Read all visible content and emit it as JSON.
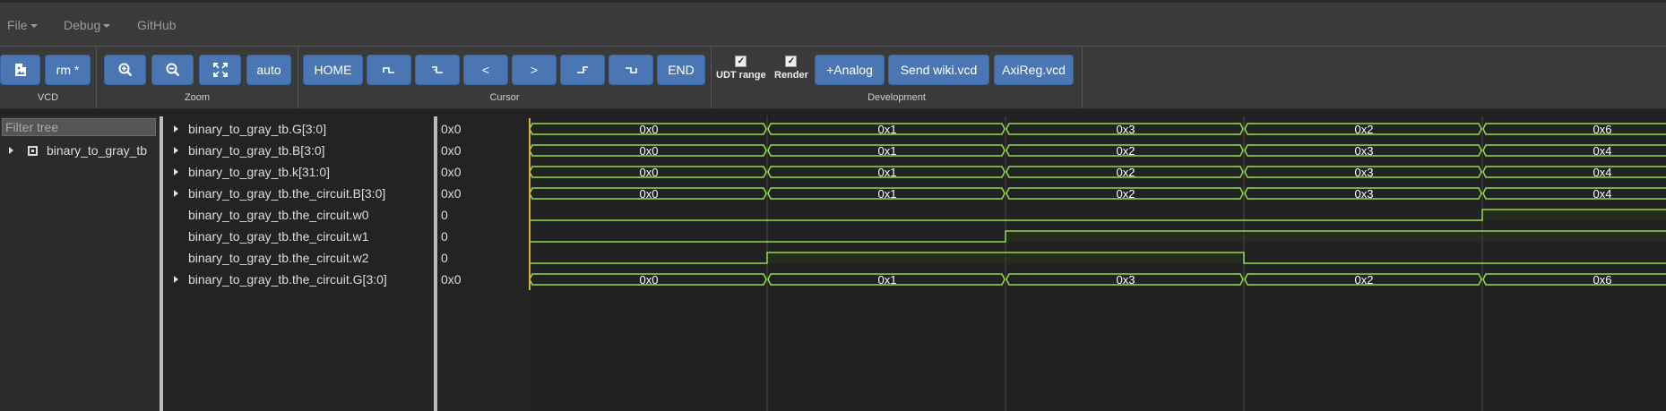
{
  "menu": {
    "file": "File",
    "debug": "Debug",
    "github": "GitHub"
  },
  "toolbar": {
    "vcd": {
      "label": "VCD",
      "rm_button": "rm *"
    },
    "zoom": {
      "label": "Zoom",
      "auto_button": "auto"
    },
    "cursor": {
      "label": "Cursor",
      "home": "HOME",
      "prev_label": "<",
      "next_label": ">",
      "end": "END"
    },
    "development": {
      "label": "Development",
      "udt_range": "UDT range",
      "render": "Render",
      "analog": "+Analog",
      "send_wiki": "Send wiki.vcd",
      "axireg": "AxiReg.vcd"
    }
  },
  "tree": {
    "filter_placeholder": "Filter tree",
    "root": "binary_to_gray_tb"
  },
  "signals": [
    {
      "name": "binary_to_gray_tb.G[3:0]",
      "value": "0x0",
      "bus": true,
      "segments": [
        "0x0",
        "0x1",
        "0x3",
        "0x2",
        "0x6"
      ]
    },
    {
      "name": "binary_to_gray_tb.B[3:0]",
      "value": "0x0",
      "bus": true,
      "segments": [
        "0x0",
        "0x1",
        "0x2",
        "0x3",
        "0x4"
      ]
    },
    {
      "name": "binary_to_gray_tb.k[31:0]",
      "value": "0x0",
      "bus": true,
      "segments": [
        "0x0",
        "0x1",
        "0x2",
        "0x3",
        "0x4"
      ]
    },
    {
      "name": "binary_to_gray_tb.the_circuit.B[3:0]",
      "value": "0x0",
      "bus": true,
      "segments": [
        "0x0",
        "0x1",
        "0x2",
        "0x3",
        "0x4"
      ]
    },
    {
      "name": "binary_to_gray_tb.the_circuit.w0",
      "value": "0",
      "bus": false,
      "levels": [
        0,
        0,
        0,
        0,
        1
      ]
    },
    {
      "name": "binary_to_gray_tb.the_circuit.w1",
      "value": "0",
      "bus": false,
      "levels": [
        0,
        0,
        1,
        1,
        1
      ]
    },
    {
      "name": "binary_to_gray_tb.the_circuit.w2",
      "value": "0",
      "bus": false,
      "levels": [
        0,
        1,
        1,
        0,
        0
      ]
    },
    {
      "name": "binary_to_gray_tb.the_circuit.G[3:0]",
      "value": "0x0",
      "bus": true,
      "segments": [
        "0x0",
        "0x1",
        "0x3",
        "0x2",
        "0x6"
      ]
    }
  ],
  "colors": {
    "wave": "#8fdc4a",
    "cursor": "#d4b23a",
    "grid": "#4a4a4a",
    "button": "#4a77b4"
  }
}
